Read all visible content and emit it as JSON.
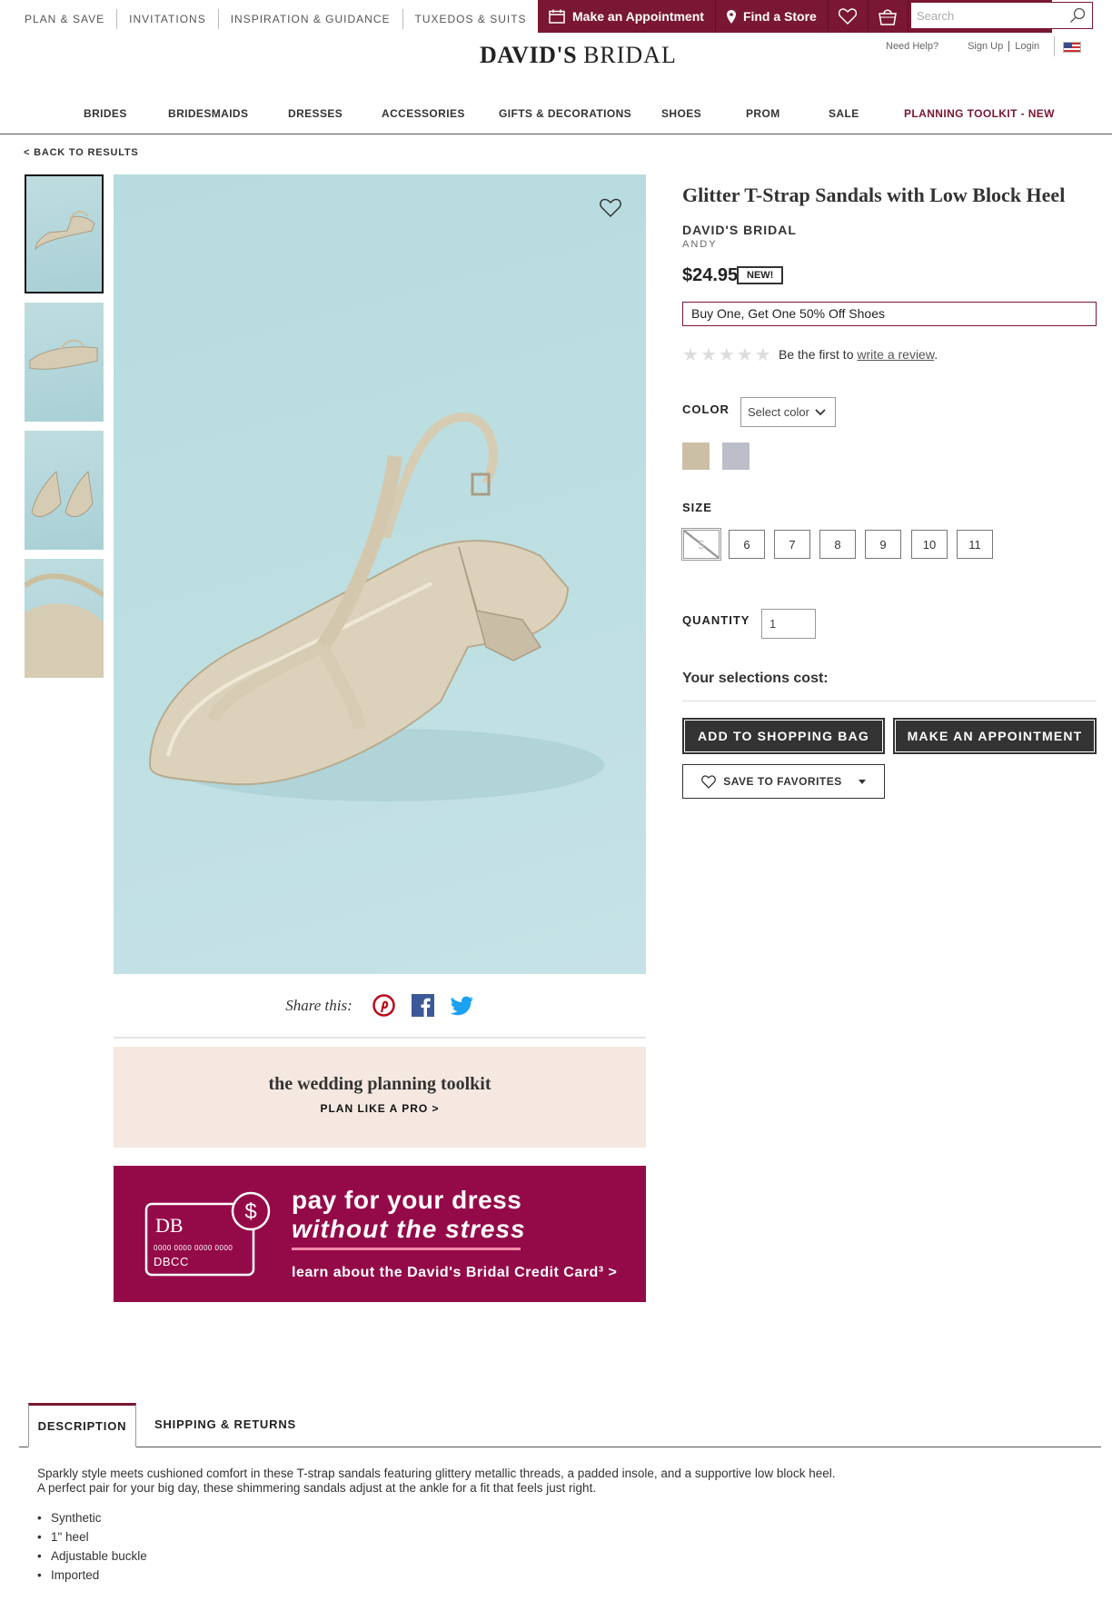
{
  "utility_nav": {
    "links": [
      "PLAN & SAVE",
      "INVITATIONS",
      "INSPIRATION & GUIDANCE",
      "TUXEDOS & SUITS"
    ],
    "appointment_label": "Make an Appointment",
    "store_label": "Find a Store",
    "search_placeholder": "Search"
  },
  "header": {
    "logo_text_1": "DAVID'S",
    "logo_text_2": "BRIDAL",
    "need_help": "Need Help?",
    "sign_up": "Sign Up",
    "login": "Login"
  },
  "main_nav": {
    "items": [
      "BRIDES",
      "BRIDESMAIDS",
      "DRESSES",
      "ACCESSORIES",
      "GIFTS & DECORATIONS",
      "SHOES",
      "PROM",
      "SALE",
      "PLANNING TOOLKIT - NEW"
    ]
  },
  "back_link": "< BACK TO RESULTS",
  "product": {
    "title": "Glitter T-Strap Sandals with Low Block Heel",
    "brand": "DAVID'S BRIDAL",
    "style_name": "ANDY",
    "price": "$24.95",
    "badge": "NEW!",
    "promo": "Buy One, Get One 50% Off Shoes",
    "rating": 0,
    "review_prefix": "Be the first to",
    "review_link": "write a review",
    "review_suffix": ".",
    "color_label": "COLOR",
    "color_select": "Select color",
    "swatches": [
      "#cbbfa6",
      "#bcbfca"
    ],
    "size_label": "SIZE",
    "sizes": [
      "5",
      "6",
      "7",
      "8",
      "9",
      "10",
      "11"
    ],
    "disabled_size": "5",
    "quantity_label": "QUANTITY",
    "quantity_value": "1",
    "cost_label": "Your selections cost:",
    "add_to_bag": "ADD TO SHOPPING BAG",
    "make_appointment": "MAKE AN APPOINTMENT",
    "save_favorites": "SAVE TO FAVORITES"
  },
  "share": {
    "label": "Share this:"
  },
  "toolkit": {
    "title": "the wedding planning toolkit",
    "cta": "PLAN LIKE A PRO >"
  },
  "promo_banner": {
    "line1": "pay for your dress",
    "line2": "without the stress",
    "line3": "learn about the David's Bridal Credit Card³ >",
    "card_number": "0000 0000 0000 0000",
    "card_name": "DBCC"
  },
  "tabs": {
    "description": "DESCRIPTION",
    "shipping": "SHIPPING & RETURNS"
  },
  "description": {
    "line1": "Sparkly style meets cushioned comfort in these T-strap sandals featuring glittery metallic threads, a padded insole, and a supportive low block heel.",
    "line2": "A perfect pair for your big day, these shimmering sandals adjust at the ankle for a fit that feels just right.",
    "bullets": [
      "Synthetic",
      "1\" heel",
      "Adjustable buckle",
      "Imported"
    ]
  },
  "colors": {
    "brand": "#7a1732",
    "promo_bg": "#940a48",
    "toolkit_bg": "#f5e8e0"
  }
}
